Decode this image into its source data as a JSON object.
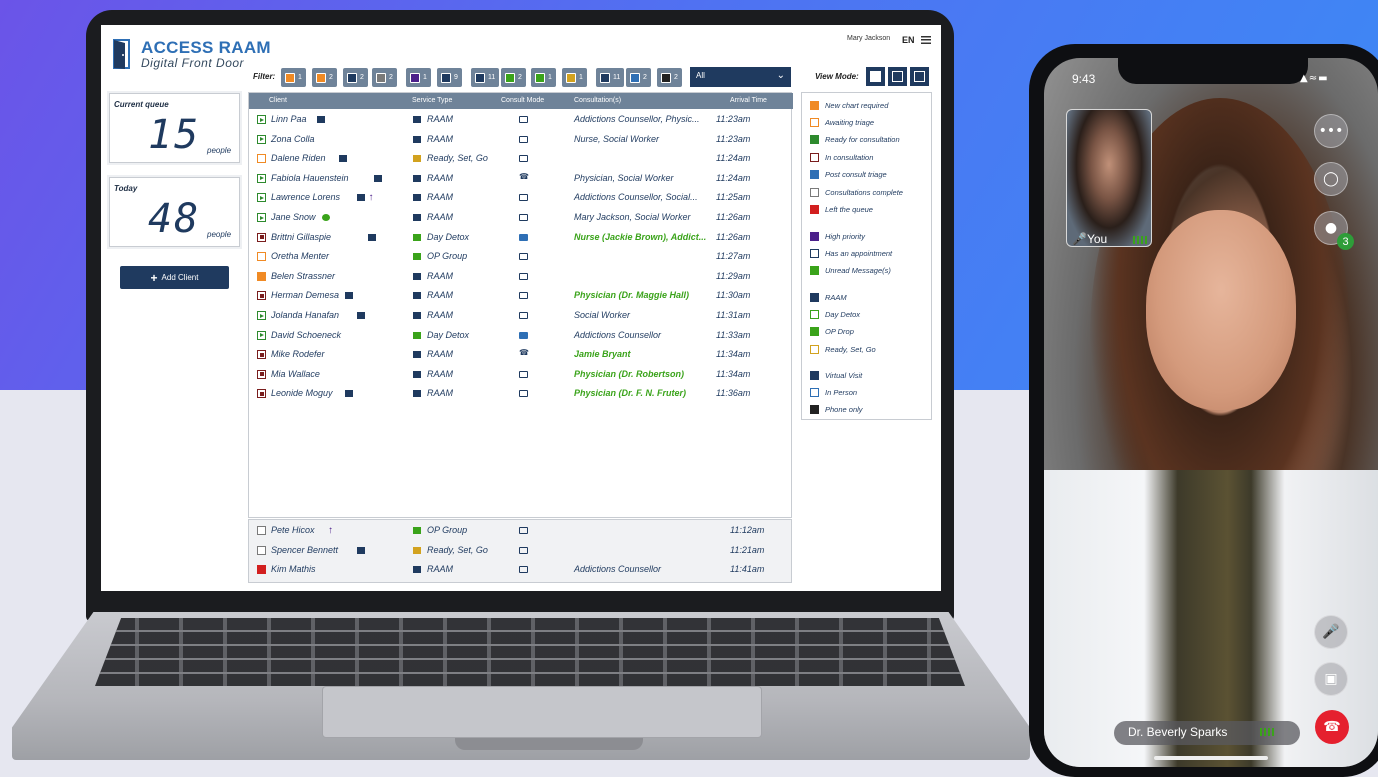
{
  "app": {
    "brand": "ACCESS RAAM",
    "tagline": "Digital Front Door",
    "user": "Mary Jackson",
    "lang": "EN"
  },
  "filter": {
    "label": "Filter:",
    "chips": [
      {
        "count": "1",
        "color": "#f08a24"
      },
      {
        "count": "2",
        "color": "#f08a24"
      },
      {
        "count": "2",
        "color": "#1f3a5f"
      },
      {
        "count": "2",
        "color": "#7a7a7a"
      },
      {
        "count": "1",
        "color": "#4b1f8a"
      },
      {
        "count": "9",
        "color": "#1f3a5f"
      },
      {
        "count": "11",
        "color": "#1f3a5f"
      },
      {
        "count": "2",
        "color": "#3aa31a"
      },
      {
        "count": "1",
        "color": "#3aa31a"
      },
      {
        "count": "1",
        "color": "#d2a21f"
      },
      {
        "count": "11",
        "color": "#1f3a5f"
      },
      {
        "count": "2",
        "color": "#2e6fb5"
      },
      {
        "count": "2",
        "color": "#222222"
      }
    ],
    "select_value": "All",
    "view_mode_label": "View Mode:"
  },
  "stats": {
    "current_queue": {
      "label": "Current queue",
      "value": "15",
      "unit": "people"
    },
    "today": {
      "label": "Today",
      "value": "48",
      "unit": "people"
    }
  },
  "add_client_label": "Add Client",
  "table": {
    "headers": [
      "Client",
      "Service Type",
      "Consult Mode",
      "Consultation(s)",
      "Arrival Time"
    ],
    "rows": [
      {
        "status": "green",
        "client": "Linn Paa",
        "appt": true,
        "service": "RAAM",
        "mode": "virtual",
        "consult": "Addictions Counsellor, Physic...",
        "time": "11:23am"
      },
      {
        "status": "green",
        "client": "Zona Colla",
        "service": "RAAM",
        "mode": "virtual",
        "consult": "Nurse, Social Worker",
        "time": "11:23am"
      },
      {
        "status": "orange",
        "client": "Dalene Riden",
        "appt": true,
        "service": "Ready, Set, Go",
        "mode": "virtual",
        "consult": "",
        "time": "11:24am"
      },
      {
        "status": "green",
        "client": "Fabiola Hauenstein",
        "appt": true,
        "service": "RAAM",
        "mode": "phone",
        "consult": "Physician, Social Worker",
        "time": "11:24am"
      },
      {
        "status": "green",
        "client": "Lawrence Lorens",
        "appt": true,
        "priority": true,
        "service": "RAAM",
        "mode": "virtual",
        "consult": "Addictions Counsellor, Social...",
        "time": "11:25am"
      },
      {
        "status": "green",
        "client": "Jane Snow",
        "msg": true,
        "service": "RAAM",
        "mode": "virtual",
        "consult": "Mary Jackson, Social Worker",
        "time": "11:26am"
      },
      {
        "status": "maroon",
        "client": "Brittni Gillaspie",
        "appt": true,
        "service": "Day Detox",
        "mode": "inperson",
        "consult": "Nurse (Jackie Brown), Addict...",
        "consult_green": true,
        "time": "11:26am"
      },
      {
        "status": "orange",
        "client": "Oretha Menter",
        "service": "OP Group",
        "mode": "virtual",
        "consult": "",
        "time": "11:27am"
      },
      {
        "status": "orangefill",
        "client": "Belen Strassner",
        "service": "RAAM",
        "mode": "virtual",
        "consult": "",
        "time": "11:29am"
      },
      {
        "status": "maroon",
        "client": "Herman Demesa",
        "appt": true,
        "service": "RAAM",
        "mode": "virtual",
        "consult": "Physician (Dr. Maggie Hall)",
        "consult_green": true,
        "time": "11:30am"
      },
      {
        "status": "green",
        "client": "Jolanda Hanafan",
        "appt": true,
        "service": "RAAM",
        "mode": "virtual",
        "consult": "Social Worker",
        "time": "11:31am"
      },
      {
        "status": "green",
        "client": "David Schoeneck",
        "service": "Day Detox",
        "mode": "inperson",
        "consult": "Addictions Counsellor",
        "time": "11:33am"
      },
      {
        "status": "maroon",
        "client": "Mike Rodefer",
        "service": "RAAM",
        "mode": "phone",
        "consult": "Jamie Bryant",
        "consult_green": true,
        "time": "11:34am"
      },
      {
        "status": "maroon",
        "client": "Mia Wallace",
        "service": "RAAM",
        "mode": "virtual",
        "consult": "Physician (Dr. Robertson)",
        "consult_green": true,
        "time": "11:34am"
      },
      {
        "status": "maroon",
        "client": "Leonide Moguy",
        "appt": true,
        "service": "RAAM",
        "mode": "virtual",
        "consult": "Physician (Dr. F. N. Fruter)",
        "consult_green": true,
        "time": "11:36am"
      }
    ],
    "done_rows": [
      {
        "status": "gray",
        "client": "Pete Hicox",
        "priority": true,
        "service": "OP Group",
        "mode": "virtual",
        "consult": "",
        "time": "11:12am"
      },
      {
        "status": "gray",
        "client": "Spencer Bennett",
        "appt": true,
        "service": "Ready, Set, Go",
        "mode": "virtual",
        "consult": "",
        "time": "11:21am"
      },
      {
        "status": "red",
        "client": "Kim Mathis",
        "service": "RAAM",
        "mode": "virtual",
        "consult": "Addictions Counsellor",
        "time": "11:41am"
      }
    ]
  },
  "legend": {
    "status": [
      "New chart required",
      "Awaiting triage",
      "Ready for consultation",
      "In consultation",
      "Post consult triage",
      "Consultations complete",
      "Left the queue"
    ],
    "flags": [
      "High priority",
      "Has an appointment",
      "Unread Message(s)"
    ],
    "services": [
      "RAAM",
      "Day Detox",
      "OP Drop",
      "Ready, Set, Go"
    ],
    "modes": [
      "Virtual Visit",
      "In Person",
      "Phone only"
    ]
  },
  "phone": {
    "time": "9:43",
    "self_label": "You",
    "participants_badge": "3",
    "caller_name": "Dr. Beverly Sparks"
  }
}
